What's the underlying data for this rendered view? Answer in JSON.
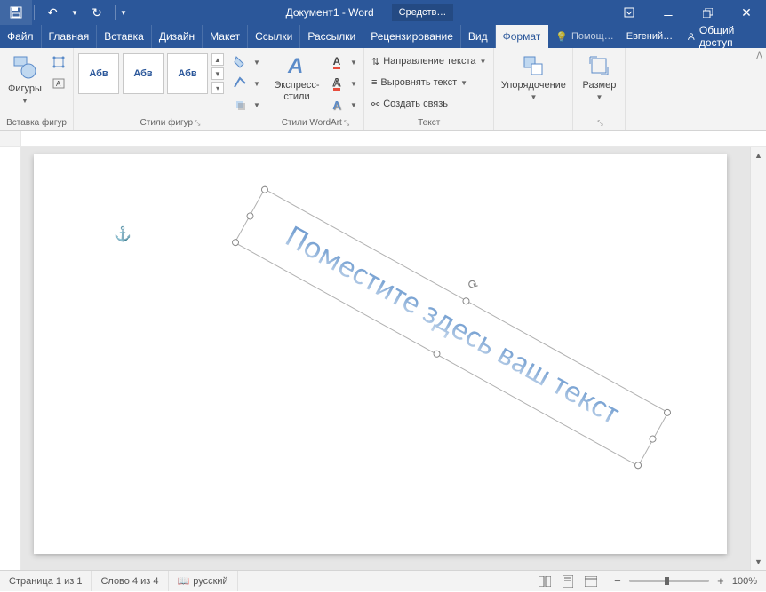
{
  "titlebar": {
    "doc_title": "Документ1 - Word",
    "tool_context": "Средств…",
    "user": "Евгений…"
  },
  "tabs": {
    "file": "Файл",
    "home": "Главная",
    "insert": "Вставка",
    "design": "Дизайн",
    "layout": "Макет",
    "references": "Ссылки",
    "mailings": "Рассылки",
    "review": "Рецензирование",
    "view": "Вид",
    "format": "Формат",
    "help": "Помощ…",
    "share": "Общий доступ"
  },
  "ribbon": {
    "shapes": {
      "btn": "Фигуры",
      "group": "Вставка фигур"
    },
    "styles": {
      "sample": "Абв",
      "group": "Стили фигур"
    },
    "wordart": {
      "btn": "Экспресс-стили",
      "group": "Стили WordArt"
    },
    "text": {
      "direction": "Направление текста",
      "align": "Выровнять текст",
      "link": "Создать связь",
      "group": "Текст"
    },
    "arrange": {
      "btn": "Упорядочение"
    },
    "size": {
      "btn": "Размер"
    }
  },
  "document": {
    "placeholder": "Поместите здесь ваш текст"
  },
  "statusbar": {
    "page": "Страница 1 из 1",
    "words": "Слово 4 из 4",
    "lang": "русский",
    "zoom": "100%"
  }
}
